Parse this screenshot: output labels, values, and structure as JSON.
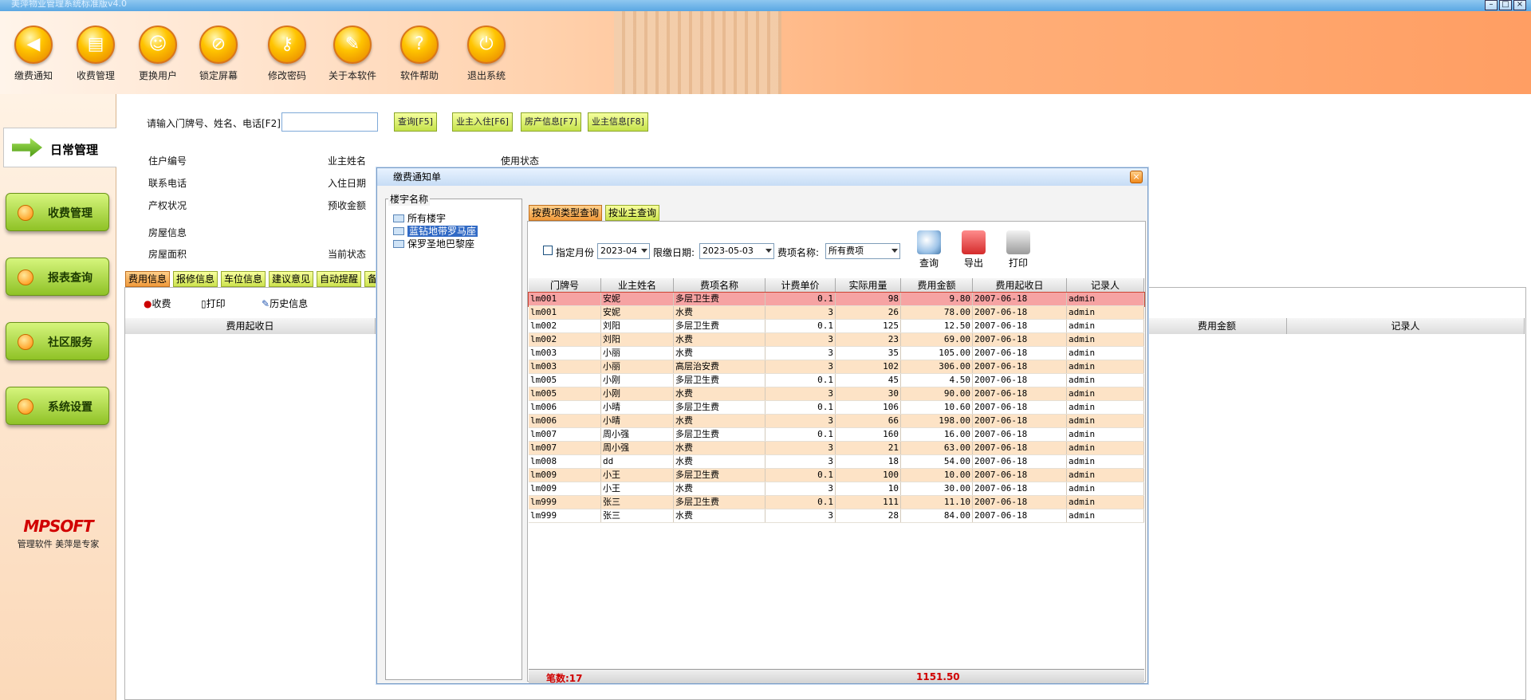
{
  "window": {
    "title": "美萍物业管理系统标准版v4.0"
  },
  "toolbar": [
    {
      "label": "缴费通知",
      "icon": "speaker-icon"
    },
    {
      "label": "收费管理",
      "icon": "document-icon"
    },
    {
      "label": "更换用户",
      "icon": "user-icon"
    },
    {
      "label": "锁定屏幕",
      "icon": "lock-icon"
    },
    {
      "label": "修改密码",
      "icon": "key-icon"
    },
    {
      "label": "关于本软件",
      "icon": "info-icon"
    },
    {
      "label": "软件帮助",
      "icon": "help-icon"
    },
    {
      "label": "退出系统",
      "icon": "power-icon"
    }
  ],
  "nav": {
    "daily": "日常管理",
    "items": [
      "收费管理",
      "报表查询",
      "社区服务",
      "系统设置"
    ]
  },
  "logo": {
    "brand": "MPSOFT",
    "slogan": "管理软件  美萍是专家"
  },
  "search": {
    "label": "请输入门牌号、姓名、电话[F2]",
    "value": ""
  },
  "buttons": {
    "query": "查询[F5]",
    "checkin": "业主入住[F6]",
    "property": "房产信息[F7]",
    "owner": "业主信息[F8]"
  },
  "info_labels": {
    "household": "住户编号",
    "owner_name": "业主姓名",
    "usage": "使用状态",
    "phone": "联系电话",
    "checkin_date": "入住日期",
    "ownership": "产权状况",
    "prepaid": "预收金额",
    "house_info": "房屋信息",
    "area": "房屋面积",
    "current_status": "当前状态"
  },
  "main_tabs": [
    "费用信息",
    "报修信息",
    "车位信息",
    "建议意见",
    "自动提醒",
    "备"
  ],
  "actions": {
    "charge": "收费",
    "print": "打印",
    "history": "历史信息"
  },
  "lower_headers": {
    "start_date": "费用起收日",
    "amount": "费用金额",
    "recorder": "记录人"
  },
  "dialog": {
    "title": "缴费通知单",
    "tree_legend": "楼宇名称",
    "tree": [
      "所有楼宇",
      "蓝钻地带罗马座",
      "保罗圣地巴黎座"
    ],
    "tree_selected": 1,
    "tabs": [
      "按费项类型查询",
      "按业主查询"
    ],
    "filter": {
      "month_label": "指定月份",
      "month_value": "2023-04",
      "deadline_label": "限缴日期:",
      "deadline_value": "2023-05-03",
      "fee_label": "费项名称:",
      "fee_value": "所有费项"
    },
    "icons": [
      {
        "label": "查询",
        "icon": "magnifier-icon"
      },
      {
        "label": "导出",
        "icon": "export-icon"
      },
      {
        "label": "打印",
        "icon": "printer-icon"
      }
    ],
    "columns": [
      "门牌号",
      "业主姓名",
      "费项名称",
      "计费单价",
      "实际用量",
      "费用金额",
      "费用起收日",
      "记录人"
    ],
    "rows": [
      [
        "lm001",
        "安妮",
        "多层卫生费",
        "0.1",
        "98",
        "9.80",
        "2007-06-18",
        "admin"
      ],
      [
        "lm001",
        "安妮",
        "水费",
        "3",
        "26",
        "78.00",
        "2007-06-18",
        "admin"
      ],
      [
        "lm002",
        "刘阳",
        "多层卫生费",
        "0.1",
        "125",
        "12.50",
        "2007-06-18",
        "admin"
      ],
      [
        "lm002",
        "刘阳",
        "水费",
        "3",
        "23",
        "69.00",
        "2007-06-18",
        "admin"
      ],
      [
        "lm003",
        "小丽",
        "水费",
        "3",
        "35",
        "105.00",
        "2007-06-18",
        "admin"
      ],
      [
        "lm003",
        "小丽",
        "高层治安费",
        "3",
        "102",
        "306.00",
        "2007-06-18",
        "admin"
      ],
      [
        "lm005",
        "小刚",
        "多层卫生费",
        "0.1",
        "45",
        "4.50",
        "2007-06-18",
        "admin"
      ],
      [
        "lm005",
        "小刚",
        "水费",
        "3",
        "30",
        "90.00",
        "2007-06-18",
        "admin"
      ],
      [
        "lm006",
        "小晴",
        "多层卫生费",
        "0.1",
        "106",
        "10.60",
        "2007-06-18",
        "admin"
      ],
      [
        "lm006",
        "小晴",
        "水费",
        "3",
        "66",
        "198.00",
        "2007-06-18",
        "admin"
      ],
      [
        "lm007",
        "周小强",
        "多层卫生费",
        "0.1",
        "160",
        "16.00",
        "2007-06-18",
        "admin"
      ],
      [
        "lm007",
        "周小强",
        "水费",
        "3",
        "21",
        "63.00",
        "2007-06-18",
        "admin"
      ],
      [
        "lm008",
        "dd",
        "水费",
        "3",
        "18",
        "54.00",
        "2007-06-18",
        "admin"
      ],
      [
        "lm009",
        "小王",
        "多层卫生费",
        "0.1",
        "100",
        "10.00",
        "2007-06-18",
        "admin"
      ],
      [
        "lm009",
        "小王",
        "水费",
        "3",
        "10",
        "30.00",
        "2007-06-18",
        "admin"
      ],
      [
        "lm999",
        "张三",
        "多层卫生费",
        "0.1",
        "111",
        "11.10",
        "2007-06-18",
        "admin"
      ],
      [
        "lm999",
        "张三",
        "水费",
        "3",
        "28",
        "84.00",
        "2007-06-18",
        "admin"
      ]
    ],
    "footer": {
      "count": "笔数:17",
      "total": "1151.50"
    }
  }
}
